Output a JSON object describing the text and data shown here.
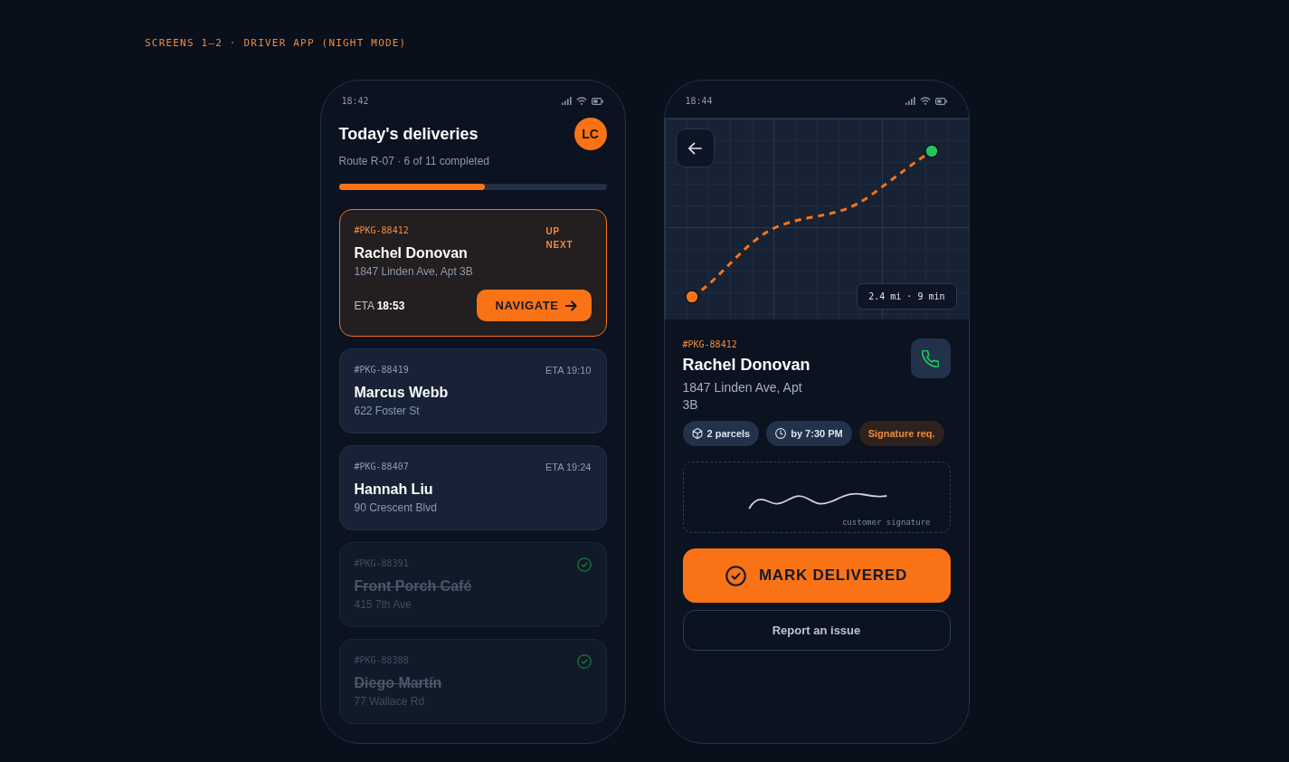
{
  "page_title": "SCREENS 1–2 · DRIVER APP (NIGHT MODE)",
  "screens": [
    {
      "kind": "list",
      "status_bar": {
        "time": "18:42"
      },
      "title": "Today's deliveries",
      "avatar": "LC",
      "subtitle": "Route R-07 · 6 of 11 completed",
      "progress": {
        "level": 0.545
      },
      "deliveries": [
        {
          "kind": "next",
          "id": "#PKG-88412",
          "name": "Rachel Donovan",
          "address": "1847 Linden Ave, Apt 3B",
          "badge": "UP NEXT",
          "eta": "ETA **18:53**",
          "action": "NAVIGATE"
        },
        {
          "kind": "upcoming",
          "id": "#PKG-88419",
          "name": "Marcus Webb",
          "address": "622 Foster St",
          "eta": "ETA 19:10"
        },
        {
          "kind": "upcoming",
          "id": "#PKG-88407",
          "name": "Hannah Liu",
          "address": "90 Crescent Blvd",
          "eta": "ETA 19:24"
        },
        {
          "kind": "done",
          "id": "#PKG-88391",
          "name": "Front Porch Café",
          "address": "415 7th Ave"
        },
        {
          "kind": "done",
          "id": "#PKG-88388",
          "name": "Diego Martín",
          "address": "77 Wallace Rd"
        }
      ]
    },
    {
      "kind": "detail",
      "status_bar": {
        "time": "18:44"
      },
      "map": {
        "summary": "2.4 mi · 9 min"
      },
      "delivery": {
        "id": "#PKG-88412",
        "name": "Rachel Donovan",
        "address": "1847 Linden Ave, Apt 3B"
      },
      "tags": [
        {
          "kind": "parcels",
          "label": "2 parcels"
        },
        {
          "kind": "deadline",
          "label": "by 7:30 PM"
        },
        {
          "kind": "signature",
          "label": "Signature req."
        }
      ],
      "signature": {
        "caption": "customer signature"
      },
      "actions": [
        {
          "kind": "primary",
          "label": "MARK DELIVERED"
        },
        {
          "kind": "secondary",
          "label": "Report an issue"
        }
      ]
    }
  ]
}
